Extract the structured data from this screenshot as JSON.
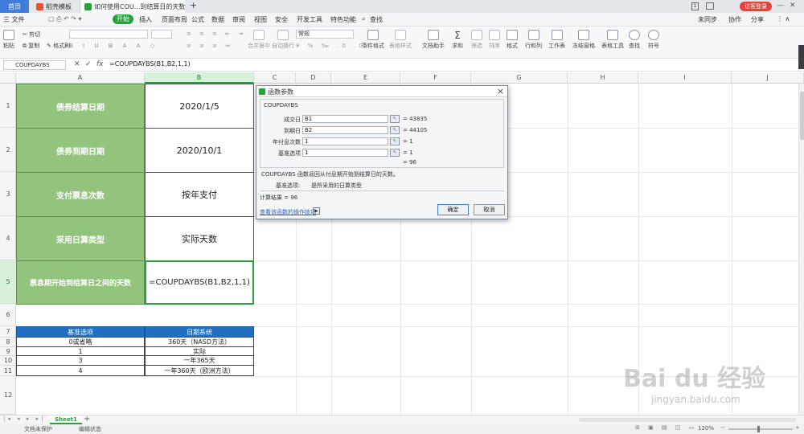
{
  "titlebar": {
    "tabs": [
      {
        "label": "首页",
        "type": "home"
      },
      {
        "label": "稻壳模板",
        "type": "inactive",
        "icon": "daoke-icon",
        "icon_color": "#e8542f"
      },
      {
        "label": "如何使用COU...到结算日的天数",
        "type": "active",
        "icon": "sheet-icon",
        "icon_color": "#24a33b"
      }
    ],
    "badge": "1",
    "login_label": "访客登录"
  },
  "menubar": {
    "file": "三 文件",
    "items": [
      "开始",
      "插入",
      "页面布局",
      "公式",
      "数据",
      "审阅",
      "视图",
      "安全",
      "开发工具",
      "特色功能"
    ],
    "active_index": 0,
    "search": "查找",
    "right": [
      "未同步",
      "协作",
      "分享"
    ]
  },
  "toolbar": {
    "cut": "剪切",
    "copy": "复制",
    "paste": "粘贴",
    "format_painter": "格式刷",
    "number_format": "常规",
    "merge": "合并居中",
    "wrap": "自动换行",
    "cond_format": "条件格式",
    "table_style": "表格样式",
    "doc_helper": "文档助手",
    "sum": "求和",
    "filter": "筛选",
    "sort": "排序",
    "format": "格式",
    "rowcol": "行和列",
    "worksheet": "工作表",
    "freeze": "冻结窗格",
    "table_tools": "表格工具",
    "find": "查找",
    "symbol": "符号"
  },
  "formulabar": {
    "namebox": "COUPDAYBS",
    "formula": "=COUPDAYBS(B1,B2,1,1)"
  },
  "columns": [
    "A",
    "B",
    "C",
    "D",
    "E",
    "F",
    "G",
    "H",
    "I",
    "J"
  ],
  "rows": [
    "1",
    "2",
    "3",
    "4",
    "5",
    "6",
    "7",
    "8",
    "9",
    "10",
    "11",
    "12"
  ],
  "sheet": {
    "labels": [
      "债券结算日期",
      "债券到期日期",
      "支付票息次数",
      "采用日算类型",
      "票息期开始到结算日之间的天数"
    ],
    "values": [
      "2020/1/5",
      "2020/10/1",
      "按年支付",
      "实际天数",
      "=COUPDAYBS(B1,B2,1,1)"
    ],
    "basis_table": {
      "headers": [
        "基准选项",
        "日期系统"
      ],
      "rows": [
        [
          "0或省略",
          "360天（NASD方法）"
        ],
        [
          "1",
          "实际"
        ],
        [
          "3",
          "一年365天"
        ],
        [
          "4",
          "一年360天（欧洲方法）"
        ]
      ]
    }
  },
  "dialog": {
    "title": "函数参数",
    "function_name": "COUPDAYBS",
    "args": [
      {
        "label": "成交日",
        "value": "B1",
        "result": "= 43835"
      },
      {
        "label": "到期日",
        "value": "B2",
        "result": "= 44105"
      },
      {
        "label": "年付息次数",
        "value": "1",
        "result": "= 1"
      },
      {
        "label": "基准选项",
        "value": "1",
        "result": "= 1"
      }
    ],
    "ref_icon": "↖",
    "result_line": "= 96",
    "description": "COUPDAYBS 函数返回从付息期开始到结算日的天数。",
    "arg_desc_label": "基准选项:",
    "arg_desc": "是所采用的日算类型",
    "calc_result": "计算结果 = 96",
    "help_link": "查看该函数的操作技巧",
    "ok": "确定",
    "cancel": "取消"
  },
  "sheetbar": {
    "tab": "Sheet1",
    "add": "+"
  },
  "statusbar": {
    "protect": "文档未保护",
    "mode": "编辑状态",
    "zoom": "120%"
  },
  "watermark": {
    "brand": "Bai du 经验",
    "url": "jingyan.baidu.com"
  },
  "colors": {
    "accent_green": "#24a33b",
    "label_fill": "#92c47d",
    "table_header": "#1f6fc3",
    "home_tab": "#3e7ddb"
  }
}
